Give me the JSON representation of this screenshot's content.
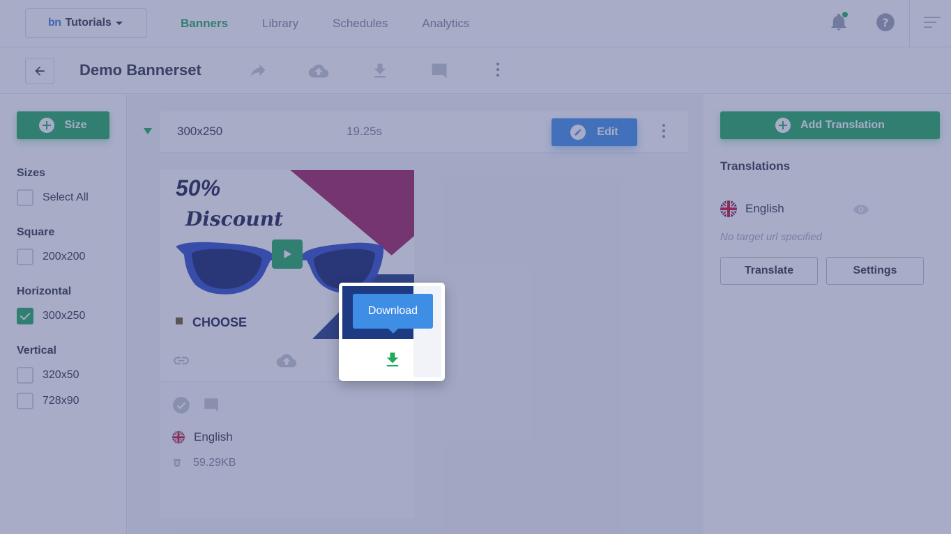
{
  "workspace": {
    "logo": "bn",
    "name": "Tutorials"
  },
  "nav": {
    "items": [
      "Banners",
      "Library",
      "Schedules",
      "Analytics"
    ],
    "active": "Banners"
  },
  "subheader": {
    "title": "Demo Bannerset"
  },
  "sidebar": {
    "add_size_label": "Size",
    "groups": [
      {
        "heading": "Sizes",
        "items": [
          {
            "label": "Select All",
            "checked": false
          }
        ]
      },
      {
        "heading": "Square",
        "items": [
          {
            "label": "200x200",
            "checked": false
          }
        ]
      },
      {
        "heading": "Horizontal",
        "items": [
          {
            "label": "300x250",
            "checked": true
          }
        ]
      },
      {
        "heading": "Vertical",
        "items": [
          {
            "label": "320x50",
            "checked": false
          },
          {
            "label": "728x90",
            "checked": false
          }
        ]
      }
    ]
  },
  "size_row": {
    "dimension": "300x250",
    "duration": "19.25s",
    "edit_label": "Edit"
  },
  "banner": {
    "headline": "50%",
    "subhead": "Discount",
    "cta": "CHOOSE",
    "language": "English",
    "file_size": "59.29KB"
  },
  "tooltip": {
    "label": "Download"
  },
  "right_panel": {
    "add_translation_label": "Add Translation",
    "heading": "Translations",
    "language": "English",
    "no_url": "No target url specified",
    "translate_label": "Translate",
    "settings_label": "Settings"
  },
  "colors": {
    "accent_green": "#1faa5c",
    "accent_blue": "#3f8ee6",
    "overlay": "#464e87"
  }
}
